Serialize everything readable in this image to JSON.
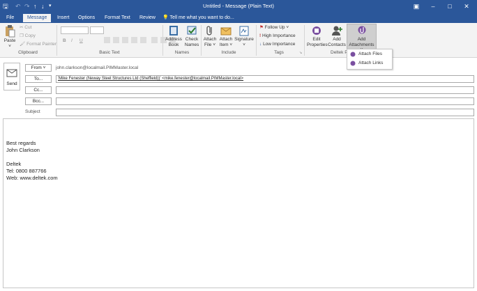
{
  "window": {
    "title": "Untitled - Message (Plain Text)"
  },
  "tabs": [
    {
      "label": "File"
    },
    {
      "label": "Message"
    },
    {
      "label": "Insert"
    },
    {
      "label": "Options"
    },
    {
      "label": "Format Text"
    },
    {
      "label": "Review"
    }
  ],
  "tellme": "Tell me what you want to do...",
  "clipboard": {
    "paste": "Paste",
    "cut": "Cut",
    "copy": "Copy",
    "format_painter": "Format Painter",
    "group": "Clipboard"
  },
  "basic_text": {
    "bold": "B",
    "italic": "I",
    "underline": "U",
    "group": "Basic Text"
  },
  "names": {
    "address_book": [
      "Address",
      "Book"
    ],
    "check_names": [
      "Check",
      "Names"
    ],
    "group": "Names"
  },
  "include": {
    "attach_file": [
      "Attach",
      "File ˅"
    ],
    "attach_item": [
      "Attach",
      "Item ˅"
    ],
    "signature": [
      "Signature",
      "˅"
    ],
    "group": "Include"
  },
  "tags": {
    "follow_up": "Follow Up ˅",
    "high": "High Importance",
    "low": "Low Importance",
    "group": "Tags"
  },
  "deltek": {
    "edit_properties": [
      "Edit",
      "Properties"
    ],
    "add_contacts": [
      "Add",
      "Contacts"
    ],
    "add_attachments": [
      "Add",
      "Attachments ˅"
    ],
    "group": "Deltek P"
  },
  "dropdown": [
    "Attach Files",
    "Attach Links"
  ],
  "compose": {
    "send": "Send",
    "from_btn": "From ˅",
    "from_value": "john.clarkson@localmail.PIMMaster.local",
    "to_btn": "To...",
    "to_value": "'Mike Fenester (Neway Steel Structures Ltd (Sheffield))' <mike.fenester@localmail.PIMMaster.local>",
    "cc_btn": "Cc...",
    "bcc_btn": "Bcc...",
    "subject_label": "Subject"
  },
  "body_lines": [
    "Best regards",
    "John Clarkson",
    "",
    "Deltek",
    "Tel: 0800 887766",
    "Web: www.deltek.com"
  ],
  "colors": {
    "accent": "#2b579a"
  }
}
